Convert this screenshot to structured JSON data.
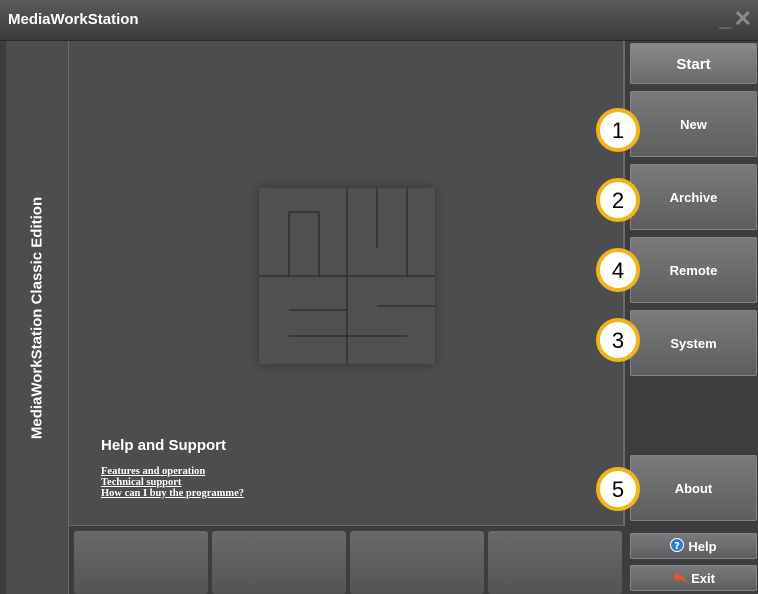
{
  "window": {
    "title": "MediaWorkStation",
    "minimize_glyph": "_",
    "close_glyph": "✕"
  },
  "sidebar": {
    "edition_label": "MediaWorkStation Classic Edition"
  },
  "logo": {
    "icon": "mws-logo-icon"
  },
  "help_support": {
    "heading": "Help and Support",
    "links": [
      "Features and operation",
      "Technical support",
      "How can I buy the programme?"
    ]
  },
  "nav": {
    "start": "Start",
    "new": "New",
    "archive": "Archive",
    "remote": "Remote",
    "system": "System",
    "about": "About",
    "help": "Help",
    "exit": "Exit"
  },
  "badges": {
    "new": "1",
    "archive": "2",
    "remote": "4",
    "system": "3",
    "about": "5"
  },
  "colors": {
    "badge_border": "#f2b41c",
    "help_icon": "#2e7bd6",
    "exit_icon": "#e8542c"
  }
}
